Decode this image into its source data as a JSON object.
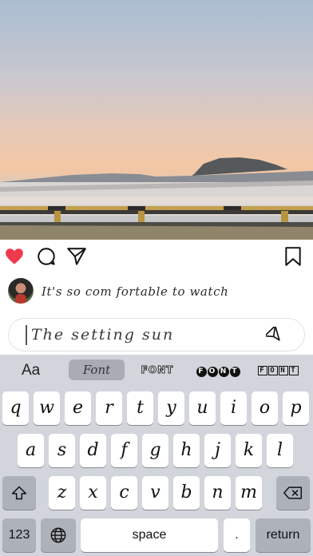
{
  "photo": {
    "icon": "sunset-photo"
  },
  "actions": {
    "like": "heart-icon",
    "comment": "comment-icon",
    "share": "send-icon",
    "save": "bookmark-icon",
    "like_color": "#ee3a4b"
  },
  "comment": {
    "text": "It's so com fortable to watch"
  },
  "input": {
    "value": "The setting sun"
  },
  "keyboard": {
    "font_selector_label": "Aa",
    "fonts": [
      "Font",
      "FONT",
      "FONT",
      "FONT"
    ],
    "row1": [
      "q",
      "w",
      "e",
      "r",
      "t",
      "y",
      "u",
      "i",
      "o",
      "p"
    ],
    "row2": [
      "a",
      "s",
      "d",
      "f",
      "g",
      "h",
      "j",
      "k",
      "l"
    ],
    "row3": [
      "z",
      "x",
      "c",
      "v",
      "b",
      "n",
      "m"
    ],
    "numbers_label": "123",
    "space_label": "space",
    "period_label": ".",
    "return_label": "return"
  }
}
